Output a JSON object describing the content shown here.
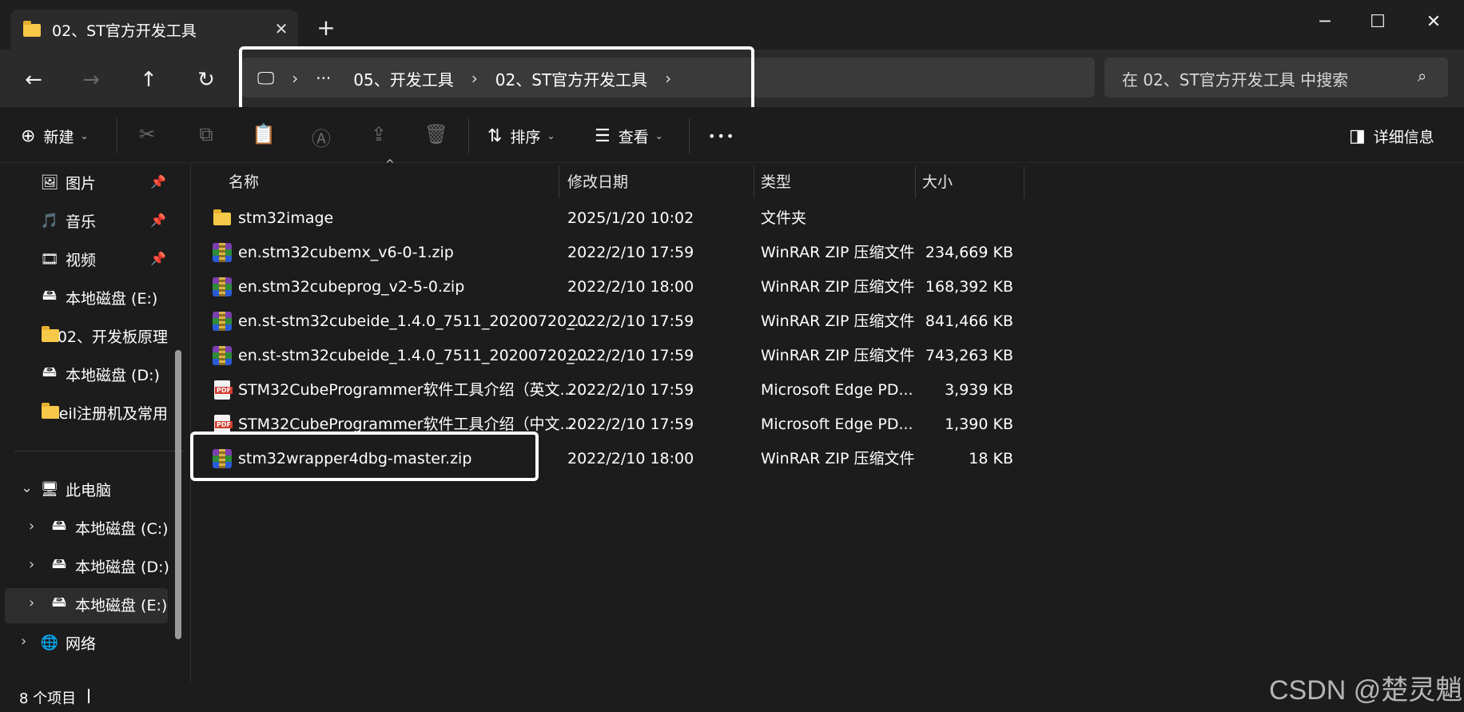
{
  "window": {
    "tab_title": "02、ST官方开发工具",
    "tab_close_glyph": "✕",
    "new_tab_glyph": "+",
    "minimize_glyph": "─",
    "maximize_glyph": "☐",
    "close_glyph": "✕"
  },
  "nav": {
    "back_glyph": "←",
    "forward_glyph": "→",
    "up_glyph": "↑",
    "refresh_glyph": "↻"
  },
  "address": {
    "computer_glyph": "🖵",
    "sep": "›",
    "ellipsis": "···",
    "crumbs": [
      "05、开发工具",
      "02、ST官方开发工具"
    ]
  },
  "search": {
    "placeholder": "在 02、ST官方开发工具 中搜索",
    "icon_glyph": "⌕"
  },
  "toolbar": {
    "new_label": "新建",
    "new_glyph": "⊕",
    "sort_label": "排序",
    "sort_glyph": "⇅",
    "view_label": "查看",
    "view_glyph": "☰",
    "more_glyph": "•••",
    "details_label": "详细信息",
    "details_glyph": "◨",
    "caret": "⌄",
    "cut_glyph": "✂",
    "copy_glyph": "⧉",
    "paste_glyph": "📋",
    "rename_glyph": "Ⓐ",
    "share_glyph": "⇪",
    "delete_glyph": "🗑"
  },
  "sidebar": {
    "pin_glyph": "📌",
    "chevron_right": "›",
    "chevron_down": "⌄",
    "quick_items": [
      {
        "label": "图片",
        "glyph": "🖼"
      },
      {
        "label": "音乐",
        "glyph": "🎵"
      },
      {
        "label": "视频",
        "glyph": "🎞"
      },
      {
        "label": "本地磁盘 (E:)",
        "glyph": "🖴"
      },
      {
        "label": "02、开发板原理",
        "glyph": ""
      },
      {
        "label": "本地磁盘 (D:)",
        "glyph": "🖴"
      },
      {
        "label": "keil注册机及常用",
        "glyph": ""
      }
    ],
    "this_pc": {
      "label": "此电脑",
      "glyph": "🖥"
    },
    "drives": [
      {
        "label": "本地磁盘 (C:)",
        "glyph": "🖴"
      },
      {
        "label": "本地磁盘 (D:)",
        "glyph": "🖴"
      },
      {
        "label": "本地磁盘 (E:)",
        "glyph": "🖴"
      }
    ],
    "network": {
      "label": "网络",
      "glyph": "🌐"
    }
  },
  "columns": {
    "name": "名称",
    "date": "修改日期",
    "type": "类型",
    "size": "大小",
    "sort_glyph": "^"
  },
  "files": [
    {
      "icon": "folder",
      "name": "stm32image",
      "date": "2025/1/20 10:02",
      "type": "文件夹",
      "size": ""
    },
    {
      "icon": "zip",
      "name": "en.stm32cubemx_v6-0-1.zip",
      "date": "2022/2/10 17:59",
      "type": "WinRAR ZIP 压缩文件",
      "size": "234,669 KB"
    },
    {
      "icon": "zip",
      "name": "en.stm32cubeprog_v2-5-0.zip",
      "date": "2022/2/10 18:00",
      "type": "WinRAR ZIP 压缩文件",
      "size": "168,392 KB"
    },
    {
      "icon": "zip",
      "name": "en.st-stm32cubeide_1.4.0_7511_20200720_...",
      "date": "2022/2/10 17:59",
      "type": "WinRAR ZIP 压缩文件",
      "size": "841,466 KB"
    },
    {
      "icon": "zip",
      "name": "en.st-stm32cubeide_1.4.0_7511_20200720_...",
      "date": "2022/2/10 17:59",
      "type": "WinRAR ZIP 压缩文件",
      "size": "743,263 KB"
    },
    {
      "icon": "pdf",
      "name": "STM32CubeProgrammer软件工具介绍（英文...",
      "date": "2022/2/10 17:59",
      "type": "Microsoft Edge PD...",
      "size": "3,939 KB"
    },
    {
      "icon": "pdf",
      "name": "STM32CubeProgrammer软件工具介绍（中文...",
      "date": "2022/2/10 17:59",
      "type": "Microsoft Edge PD...",
      "size": "1,390 KB"
    },
    {
      "icon": "zip",
      "name": "stm32wrapper4dbg-master.zip",
      "date": "2022/2/10 18:00",
      "type": "WinRAR ZIP 压缩文件",
      "size": "18 KB"
    }
  ],
  "status": {
    "item_count": "8 个项目"
  },
  "watermark": "CSDN @楚灵魈",
  "colors": {
    "background": "#1c1c1c",
    "toolbar_bg": "#2b2b2b",
    "highlight_box": "#ffffff",
    "folder": "#f7c948"
  }
}
